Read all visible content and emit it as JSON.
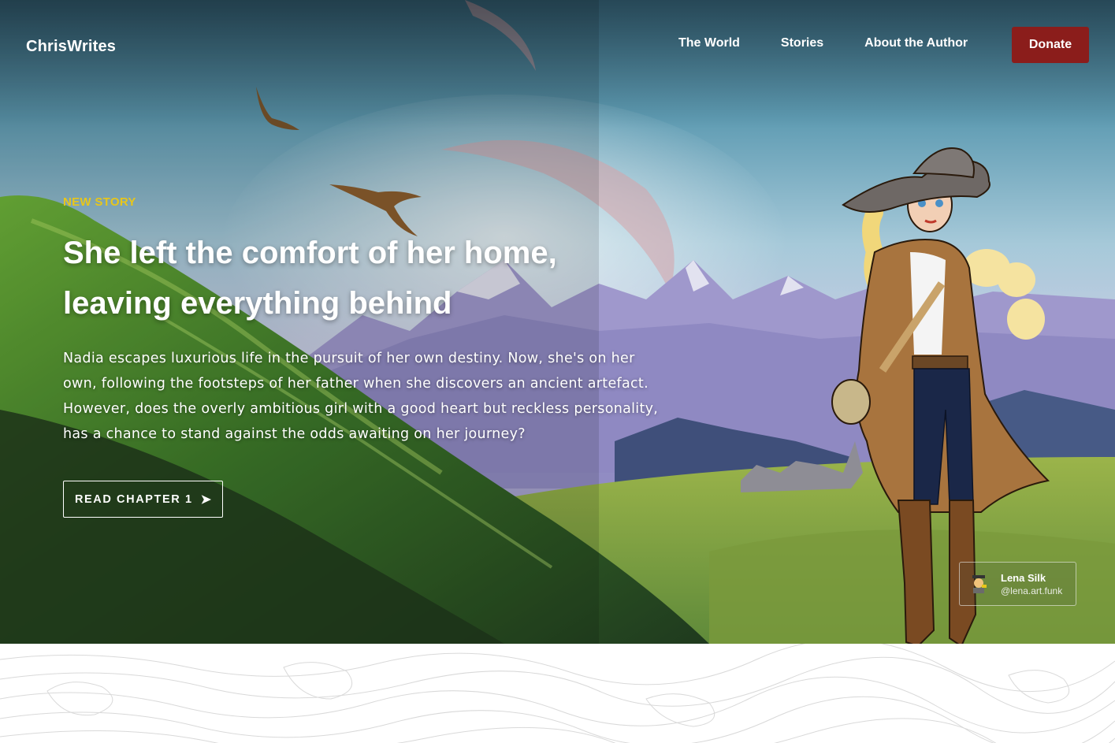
{
  "nav": {
    "brand": "ChrisWrites",
    "links": [
      {
        "label": "The World"
      },
      {
        "label": "Stories"
      },
      {
        "label": "About the Author"
      }
    ],
    "donate_label": "Donate"
  },
  "hero": {
    "eyebrow": "NEW STORY",
    "headline": "She left the comfort of her home, leaving everything behind",
    "description": "Nadia escapes luxurious life in the pursuit of her own destiny. Now, she's on her own, following the footsteps of her father when she discovers an ancient artefact. However, does the overly ambitious girl with a good heart but reckless personality, has a chance to stand against the odds awaiting on her journey?",
    "cta_label": "READ CHAPTER 1",
    "cta_icon": "arrow-right-icon"
  },
  "credit": {
    "name": "Lena Silk",
    "handle": "@lena.art.funk",
    "icon": "artist-emoji-icon"
  },
  "colors": {
    "accent_yellow": "#e8c61a",
    "donate_red": "#8b1d1b"
  }
}
